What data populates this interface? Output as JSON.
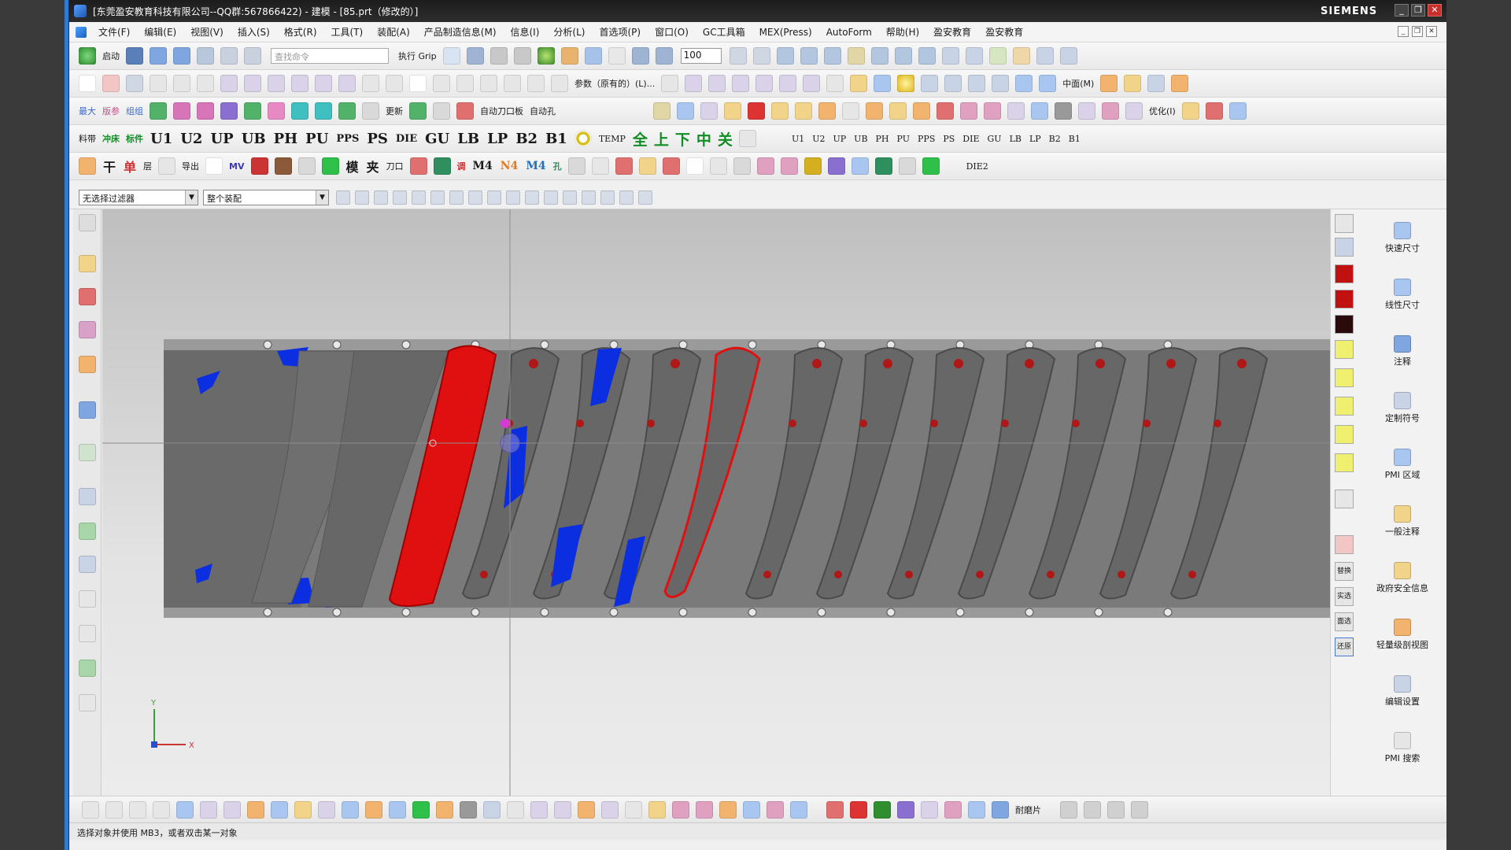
{
  "window": {
    "title": "[东莞盈安教育科技有限公司--QQ群:567866422) - 建模 - [85.prt（修改的）]",
    "brand": "SIEMENS",
    "controls": [
      "_",
      "❐",
      "✕"
    ]
  },
  "menu": {
    "items": [
      "文件(F)",
      "编辑(E)",
      "视图(V)",
      "插入(S)",
      "格式(R)",
      "工具(T)",
      "装配(A)",
      "产品制造信息(M)",
      "信息(I)",
      "分析(L)",
      "首选项(P)",
      "窗口(O)",
      "GC工具箱",
      "MEX(Press)",
      "AutoForm",
      "帮助(H)",
      "盈安教育",
      "盈安教育"
    ]
  },
  "toolbar1": {
    "start_label": "启动",
    "search_placeholder": "查找命令",
    "grip_label": "执行 Grip",
    "zoom_value": "100"
  },
  "toolbar2": {
    "params_label": "参数（原有的）(L)...",
    "layer_label": "中面(M)"
  },
  "toolbar3": {
    "labels": [
      "最大",
      "版参",
      "组组",
      "更新",
      "自动刀口板",
      "自动孔",
      "优化(I)"
    ]
  },
  "toolbar4": {
    "left_labels": [
      "料带",
      "冲床",
      "标件"
    ],
    "codes": [
      "U1",
      "U2",
      "UP",
      "UB",
      "PH",
      "PU",
      "PPS",
      "PS",
      "DIE",
      "GU",
      "LB",
      "LP",
      "B2",
      "B1"
    ],
    "temp_label": "TEMP",
    "green_labels": [
      "全",
      "上",
      "下",
      "中",
      "关"
    ],
    "small_codes": [
      "U1",
      "U2",
      "UP",
      "UB",
      "PH",
      "PU",
      "PPS",
      "PS",
      "DIE",
      "GU",
      "LB",
      "LP",
      "B2",
      "B1"
    ]
  },
  "toolbar5": {
    "labels": [
      "干",
      "单",
      "层",
      "导出",
      "MV",
      "模",
      "夹",
      "刀口",
      "调",
      "M4",
      "N4",
      "M4",
      "孔",
      "DIE2"
    ]
  },
  "filterbar": {
    "selection_filter": "无选择过滤器",
    "assembly_scope": "整个装配"
  },
  "right_panel": {
    "items": [
      "快速尺寸",
      "线性尺寸",
      "注释",
      "定制符号",
      "PMI 区域",
      "一般注释",
      "政府安全信息",
      "轻量级剖视图",
      "编辑设置",
      "PMI 搜索"
    ],
    "strip_labels": [
      "替换",
      "实选",
      "面选",
      "还原"
    ]
  },
  "bottom_toolbar": {
    "label": "耐磨片"
  },
  "status": {
    "text": "选择对象并使用 MB3，或者双击某一对象"
  },
  "triad": {
    "x_label": "X",
    "y_label": "Y"
  },
  "colors": {
    "accent_blue": "#0b2ee0",
    "accent_red": "#e01010",
    "part_gray": "#676767",
    "strip_gray": "#7b7b7b"
  }
}
